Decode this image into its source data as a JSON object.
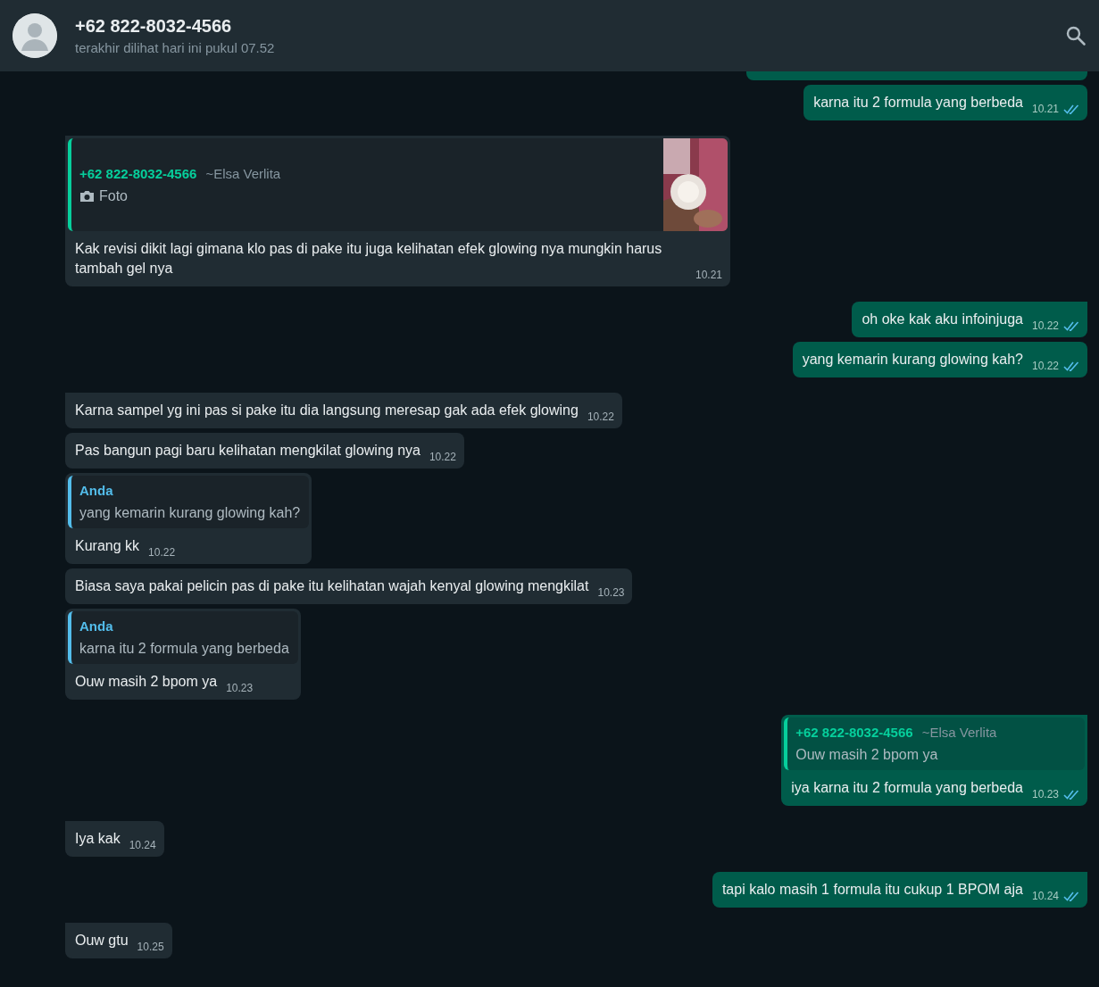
{
  "header": {
    "contact": "+62 822-8032-4566",
    "status": "terakhir dilihat hari ini pukul 07.52"
  },
  "messages": [
    {
      "outgoing": true,
      "kind": "clipped",
      "tail": false
    },
    {
      "outgoing": true,
      "kind": "text",
      "tail": false,
      "text": "karna itu 2 formula yang berbeda",
      "time": "10.21",
      "read": true
    },
    {
      "outgoing": false,
      "kind": "reply",
      "tail": true,
      "quote": {
        "author": "+62 822-8032-4566",
        "alias": "~Elsa Verlita",
        "color": "#06cf9c",
        "photo": true,
        "text": "Foto"
      },
      "text": "Kak revisi dikit lagi gimana klo pas di pake itu juga kelihatan efek glowing nya mungkin harus tambah gel nya",
      "time": "10.21"
    },
    {
      "outgoing": true,
      "kind": "text",
      "tail": true,
      "text": "oh oke kak aku infoinjuga",
      "time": "10.22",
      "read": true
    },
    {
      "outgoing": true,
      "kind": "text",
      "tail": false,
      "text": "yang kemarin kurang glowing kah?",
      "time": "10.22",
      "read": true
    },
    {
      "outgoing": false,
      "kind": "text",
      "tail": true,
      "text": "Karna sampel yg ini pas si pake itu dia langsung meresap gak ada efek glowing",
      "time": "10.22"
    },
    {
      "outgoing": false,
      "kind": "text",
      "tail": false,
      "text": "Pas bangun pagi baru kelihatan mengkilat glowing nya",
      "time": "10.22"
    },
    {
      "outgoing": false,
      "kind": "reply",
      "tail": false,
      "quote": {
        "author": "Anda",
        "color": "#53bdeb",
        "text": "yang kemarin kurang glowing kah?"
      },
      "text": "Kurang kk",
      "time": "10.22"
    },
    {
      "outgoing": false,
      "kind": "text",
      "tail": false,
      "text": "Biasa saya pakai pelicin pas di pake itu kelihatan wajah kenyal glowing mengkilat",
      "time": "10.23"
    },
    {
      "outgoing": false,
      "kind": "reply",
      "tail": false,
      "quote": {
        "author": "Anda",
        "color": "#53bdeb",
        "text": "karna itu 2 formula yang berbeda"
      },
      "text": "Ouw masih 2 bpom ya",
      "time": "10.23"
    },
    {
      "outgoing": true,
      "kind": "reply",
      "tail": true,
      "quote": {
        "author": "+62 822-8032-4566",
        "alias": "~Elsa Verlita",
        "color": "#06cf9c",
        "text": "Ouw masih 2 bpom ya"
      },
      "text": "iya karna itu 2 formula yang berbeda",
      "time": "10.23",
      "read": true
    },
    {
      "outgoing": false,
      "kind": "text",
      "tail": true,
      "text": "Iya kak",
      "time": "10.24"
    },
    {
      "outgoing": true,
      "kind": "text",
      "tail": true,
      "text": "tapi kalo masih 1 formula itu cukup 1 BPOM aja",
      "time": "10.24",
      "read": true
    },
    {
      "outgoing": false,
      "kind": "text",
      "tail": true,
      "text": "Ouw gtu",
      "time": "10.25"
    }
  ]
}
